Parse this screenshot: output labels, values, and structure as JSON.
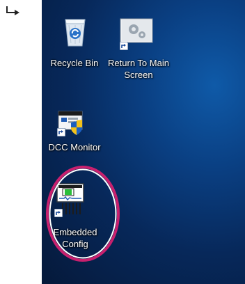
{
  "desktop": {
    "icons": [
      {
        "label": "Recycle Bin",
        "icon": "recycle-bin-icon"
      },
      {
        "label": "Return To Main Screen",
        "icon": "settings-gears-icon"
      },
      {
        "label": "DCC Monitor",
        "icon": "dcc-monitor-icon"
      },
      {
        "label": "Embedded Config",
        "icon": "embedded-config-icon"
      }
    ]
  },
  "annotation": {
    "highlight_color": "#c8206e",
    "target": "Embedded Config"
  }
}
